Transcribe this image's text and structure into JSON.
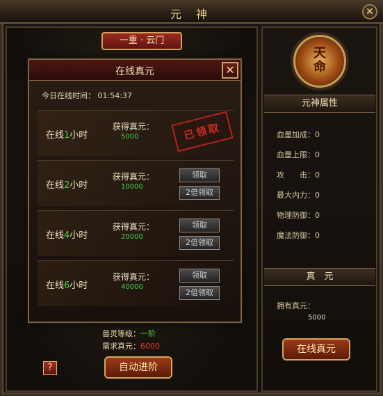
{
  "window": {
    "title": "元 神",
    "close": "✕"
  },
  "stage_tab": "一重 · 云门",
  "modal": {
    "title": "在线真元",
    "close": "✕",
    "online_time": "今日在线时间： 01:54:37",
    "rows": [
      {
        "prefix": "在线",
        "num": "1",
        "suffix": "小时",
        "gain_label": "获得真元：",
        "value": "5000",
        "stamp": "已领取"
      },
      {
        "prefix": "在线",
        "num": "2",
        "suffix": "小时",
        "gain_label": "获得真元：",
        "value": "10000",
        "claim": "领取",
        "double": "2倍领取"
      },
      {
        "prefix": "在线",
        "num": "4",
        "suffix": "小时",
        "gain_label": "获得真元：",
        "value": "20000",
        "claim": "领取",
        "double": "2倍领取"
      },
      {
        "prefix": "在线",
        "num": "6",
        "suffix": "小时",
        "gain_label": "获得真元：",
        "value": "40000",
        "claim": "领取",
        "double": "2倍领取"
      }
    ]
  },
  "pet": {
    "level_label": "兽灵等级：",
    "level_value": "一阶",
    "need_label": "需求真元：",
    "need_value": "6000"
  },
  "help": "?",
  "auto_button": "自动进阶",
  "emblem": {
    "line1": "天",
    "line2": "命"
  },
  "attributes": {
    "title": "元神属性",
    "items": [
      "血量加成：0",
      "血量上限：0",
      "攻　　击：0",
      "最大内力：0",
      "物理防御：0",
      "魔法防御：0"
    ]
  },
  "zhenyuan": {
    "title": "真　元",
    "own_label": "拥有真元：",
    "own_value": "5000",
    "button": "在线真元"
  }
}
